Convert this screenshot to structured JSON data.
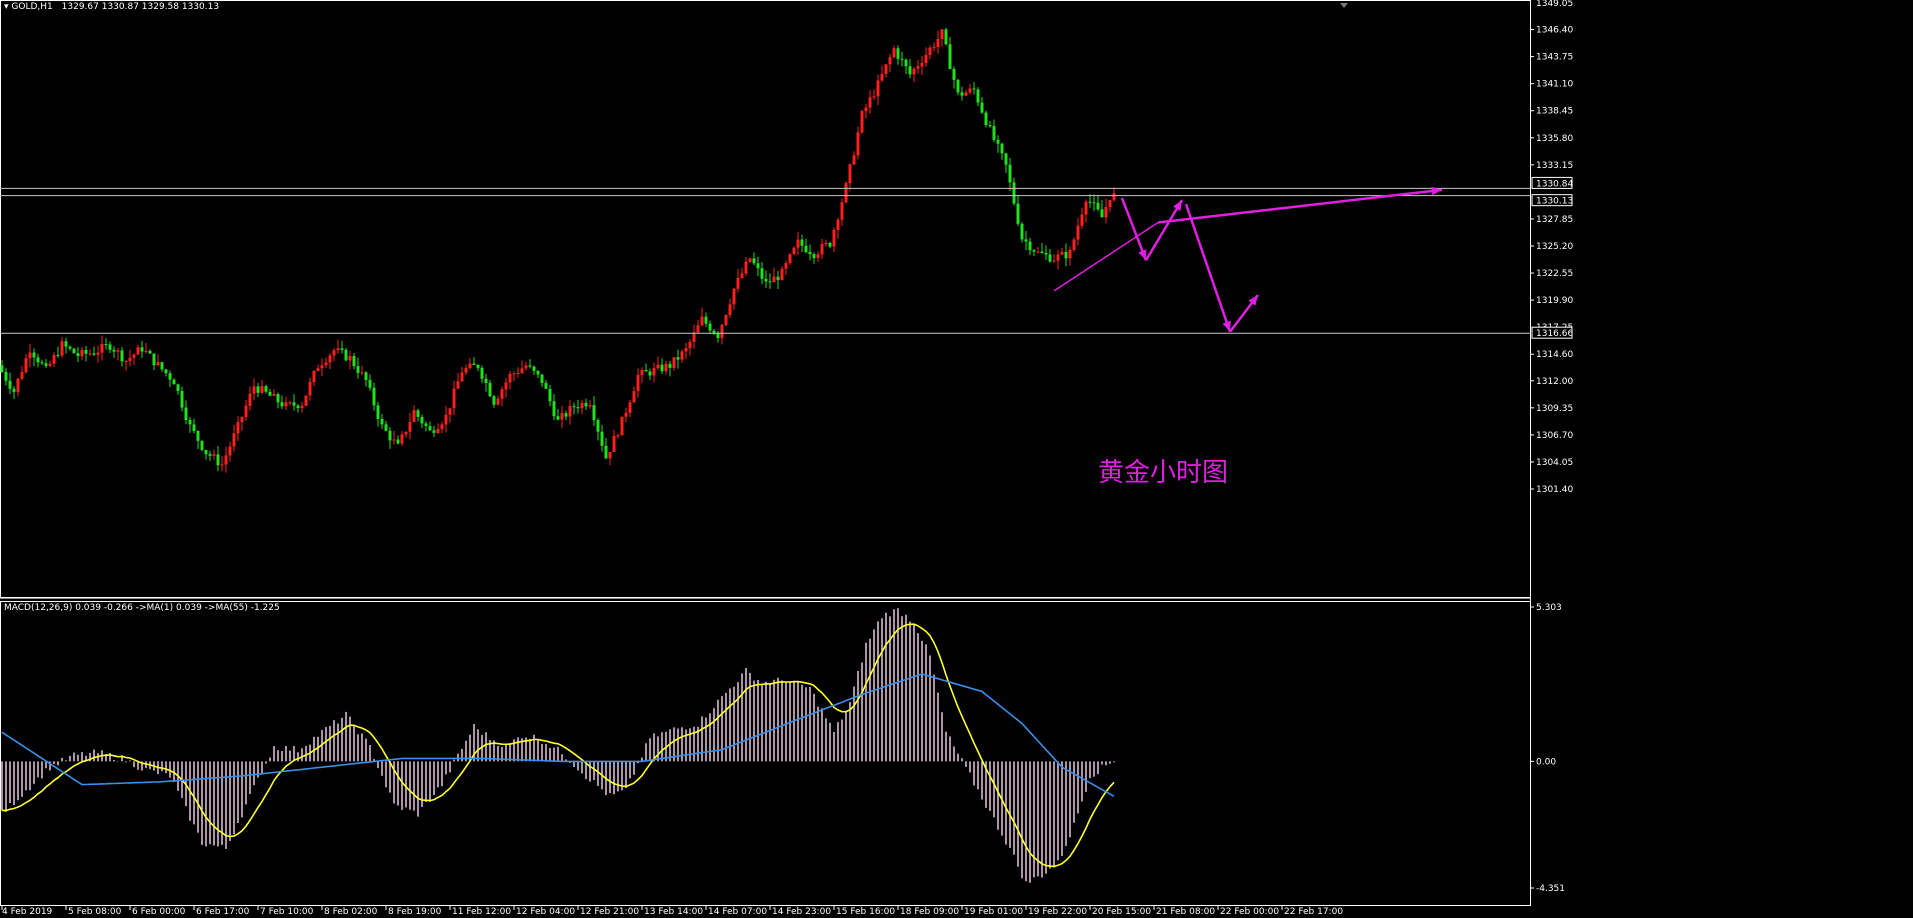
{
  "header": {
    "symbol": "GOLD,H1",
    "ohlc": "1329.67 1330.87 1329.58 1330.13"
  },
  "macd_header": {
    "text": "MACD(12,26,9) 0.039 -0.266  ->MA(1) 0.039  ->MA(55) -1.225"
  },
  "annotation": {
    "text": "黄金小时图",
    "color": "#e020e0"
  },
  "colors": {
    "background": "#000000",
    "bull_candle": "#ff2020",
    "bear_candle": "#20e020",
    "axis": "#ffffff",
    "grid_level": "#c8c8c8",
    "trend_arrows": "#e020e0",
    "macd_hist": "#f4d6ec",
    "signal_yellow": "#ffff30",
    "ma55_blue": "#3c8ee8"
  },
  "chart_data": [
    {
      "type": "candlestick",
      "title": "GOLD,H1",
      "ylim": [
        1301.4,
        1349.0
      ],
      "y_ticks": [
        1346.4,
        1343.75,
        1341.1,
        1338.45,
        1335.8,
        1333.15,
        1327.85,
        1325.2,
        1322.55,
        1319.9,
        1314.6,
        1312.0,
        1309.35,
        1306.7,
        1304.05,
        1301.4
      ],
      "y_top_tick": "1349.05",
      "y_partial_tick": "1317.25",
      "price_tags": [
        "1330.84",
        "1330.13",
        "1316.66"
      ],
      "horizontal_levels": [
        1330.84,
        1330.13,
        1316.66
      ],
      "x_tick_labels": [
        "4 Feb 2019",
        "5 Feb 08:00",
        "6 Feb 00:00",
        "6 Feb 17:00",
        "7 Feb 10:00",
        "8 Feb 02:00",
        "8 Feb 19:00",
        "11 Feb 12:00",
        "12 Feb 04:00",
        "12 Feb 21:00",
        "13 Feb 14:00",
        "14 Feb 07:00",
        "14 Feb 23:00",
        "15 Feb 16:00",
        "18 Feb 09:00",
        "19 Feb 01:00",
        "19 Feb 22:00",
        "20 Feb 15:00",
        "21 Feb 08:00",
        "22 Feb 00:00",
        "22 Feb 17:00"
      ],
      "price_path": [
        [
          0,
          1313.5
        ],
        [
          4,
          1311.0
        ],
        [
          8,
          1315.2
        ],
        [
          12,
          1313.0
        ],
        [
          16,
          1315.5
        ],
        [
          20,
          1314.5
        ],
        [
          24,
          1314.8
        ],
        [
          28,
          1315.5
        ],
        [
          32,
          1314.0
        ],
        [
          36,
          1315.2
        ],
        [
          40,
          1313.5
        ],
        [
          44,
          1312.0
        ],
        [
          48,
          1307.5
        ],
        [
          52,
          1305.0
        ],
        [
          56,
          1303.8
        ],
        [
          60,
          1307.5
        ],
        [
          64,
          1311.5
        ],
        [
          68,
          1310.5
        ],
        [
          72,
          1309.5
        ],
        [
          76,
          1309.8
        ],
        [
          80,
          1313.5
        ],
        [
          84,
          1315.0
        ],
        [
          88,
          1314.2
        ],
        [
          92,
          1312.0
        ],
        [
          96,
          1307.5
        ],
        [
          100,
          1305.5
        ],
        [
          104,
          1309.0
        ],
        [
          108,
          1307.0
        ],
        [
          112,
          1308.5
        ],
        [
          116,
          1313.0
        ],
        [
          120,
          1313.5
        ],
        [
          124,
          1310.0
        ],
        [
          128,
          1312.5
        ],
        [
          132,
          1313.5
        ],
        [
          136,
          1312.0
        ],
        [
          140,
          1308.0
        ],
        [
          144,
          1309.5
        ],
        [
          148,
          1310.0
        ],
        [
          152,
          1304.5
        ],
        [
          156,
          1308.0
        ],
        [
          160,
          1312.5
        ],
        [
          164,
          1313.0
        ],
        [
          168,
          1313.5
        ],
        [
          172,
          1315.0
        ],
        [
          176,
          1318.0
        ],
        [
          180,
          1316.5
        ],
        [
          184,
          1321.0
        ],
        [
          188,
          1324.0
        ],
        [
          192,
          1321.5
        ],
        [
          196,
          1322.5
        ],
        [
          200,
          1325.5
        ],
        [
          204,
          1324.5
        ],
        [
          208,
          1325.5
        ],
        [
          212,
          1331.0
        ],
        [
          216,
          1338.0
        ],
        [
          220,
          1341.0
        ],
        [
          224,
          1344.5
        ],
        [
          228,
          1342.0
        ],
        [
          232,
          1344.0
        ],
        [
          236,
          1346.0
        ],
        [
          240,
          1340.0
        ],
        [
          244,
          1340.5
        ],
        [
          248,
          1336.5
        ],
        [
          252,
          1333.0
        ],
        [
          256,
          1326.0
        ],
        [
          260,
          1324.5
        ],
        [
          264,
          1324.0
        ],
        [
          268,
          1324.5
        ],
        [
          272,
          1330.0
        ],
        [
          276,
          1328.0
        ],
        [
          278,
          1330.1
        ]
      ],
      "trend_lines": [
        {
          "kind": "line",
          "from": [
            263,
            1320.8
          ],
          "to": [
            289,
            1327.5
          ]
        },
        {
          "kind": "arrow",
          "from": [
            289,
            1327.5
          ],
          "to": [
            360,
            1330.7
          ]
        },
        {
          "kind": "arrow",
          "from": [
            280,
            1329.9
          ],
          "to": [
            286,
            1323.8
          ]
        },
        {
          "kind": "arrow",
          "from": [
            286,
            1323.8
          ],
          "to": [
            295,
            1329.7
          ]
        },
        {
          "kind": "arrow",
          "from": [
            296,
            1329.3
          ],
          "to": [
            307,
            1316.8
          ]
        },
        {
          "kind": "arrow",
          "from": [
            307,
            1316.8
          ],
          "to": [
            314,
            1320.4
          ]
        }
      ]
    },
    {
      "type": "bar",
      "title": "MACD(12,26,9) 0.039 -0.266  ->MA(1) 0.039  ->MA(55) -1.225",
      "ylim": [
        -4.351,
        5.303
      ],
      "y_ticks": [
        5.303,
        0.0,
        -4.351
      ],
      "series": [
        {
          "name": "MACD",
          "style": "histogram"
        },
        {
          "name": "MA(1)",
          "style": "line"
        },
        {
          "name": "MA(55)",
          "style": "line"
        }
      ],
      "macd_path": [
        [
          0,
          -1.8
        ],
        [
          6,
          -1.0
        ],
        [
          12,
          -0.2
        ],
        [
          18,
          0.2
        ],
        [
          24,
          0.3
        ],
        [
          30,
          0.1
        ],
        [
          36,
          -0.3
        ],
        [
          42,
          -0.5
        ],
        [
          50,
          -2.8
        ],
        [
          56,
          -3.0
        ],
        [
          62,
          -1.2
        ],
        [
          68,
          0.5
        ],
        [
          74,
          0.4
        ],
        [
          80,
          1.0
        ],
        [
          86,
          1.6
        ],
        [
          92,
          0.5
        ],
        [
          98,
          -1.5
        ],
        [
          104,
          -1.8
        ],
        [
          110,
          -0.8
        ],
        [
          114,
          0.2
        ],
        [
          118,
          1.2
        ],
        [
          122,
          0.8
        ],
        [
          126,
          0.5
        ],
        [
          130,
          0.9
        ],
        [
          134,
          0.8
        ],
        [
          140,
          0.3
        ],
        [
          146,
          -0.5
        ],
        [
          152,
          -1.2
        ],
        [
          156,
          -1.0
        ],
        [
          162,
          0.8
        ],
        [
          168,
          1.1
        ],
        [
          174,
          1.3
        ],
        [
          180,
          2.2
        ],
        [
          186,
          3.1
        ],
        [
          190,
          2.7
        ],
        [
          196,
          2.8
        ],
        [
          202,
          2.5
        ],
        [
          208,
          1.0
        ],
        [
          212,
          2.0
        ],
        [
          216,
          4.0
        ],
        [
          220,
          5.0
        ],
        [
          224,
          5.2
        ],
        [
          228,
          4.8
        ],
        [
          232,
          3.6
        ],
        [
          236,
          1.0
        ],
        [
          240,
          0.0
        ],
        [
          246,
          -1.5
        ],
        [
          252,
          -3.0
        ],
        [
          256,
          -4.2
        ],
        [
          260,
          -3.9
        ],
        [
          264,
          -3.5
        ],
        [
          268,
          -2.2
        ],
        [
          272,
          -0.5
        ],
        [
          278,
          0.04
        ]
      ],
      "ma55_path": [
        [
          0,
          1.0
        ],
        [
          20,
          -0.8
        ],
        [
          40,
          -0.7
        ],
        [
          60,
          -0.5
        ],
        [
          80,
          -0.2
        ],
        [
          100,
          0.1
        ],
        [
          120,
          0.1
        ],
        [
          140,
          0.0
        ],
        [
          160,
          0.0
        ],
        [
          180,
          0.4
        ],
        [
          200,
          1.5
        ],
        [
          215,
          2.3
        ],
        [
          230,
          3.0
        ],
        [
          245,
          2.4
        ],
        [
          255,
          1.3
        ],
        [
          265,
          -0.2
        ],
        [
          278,
          -1.2
        ]
      ]
    }
  ]
}
